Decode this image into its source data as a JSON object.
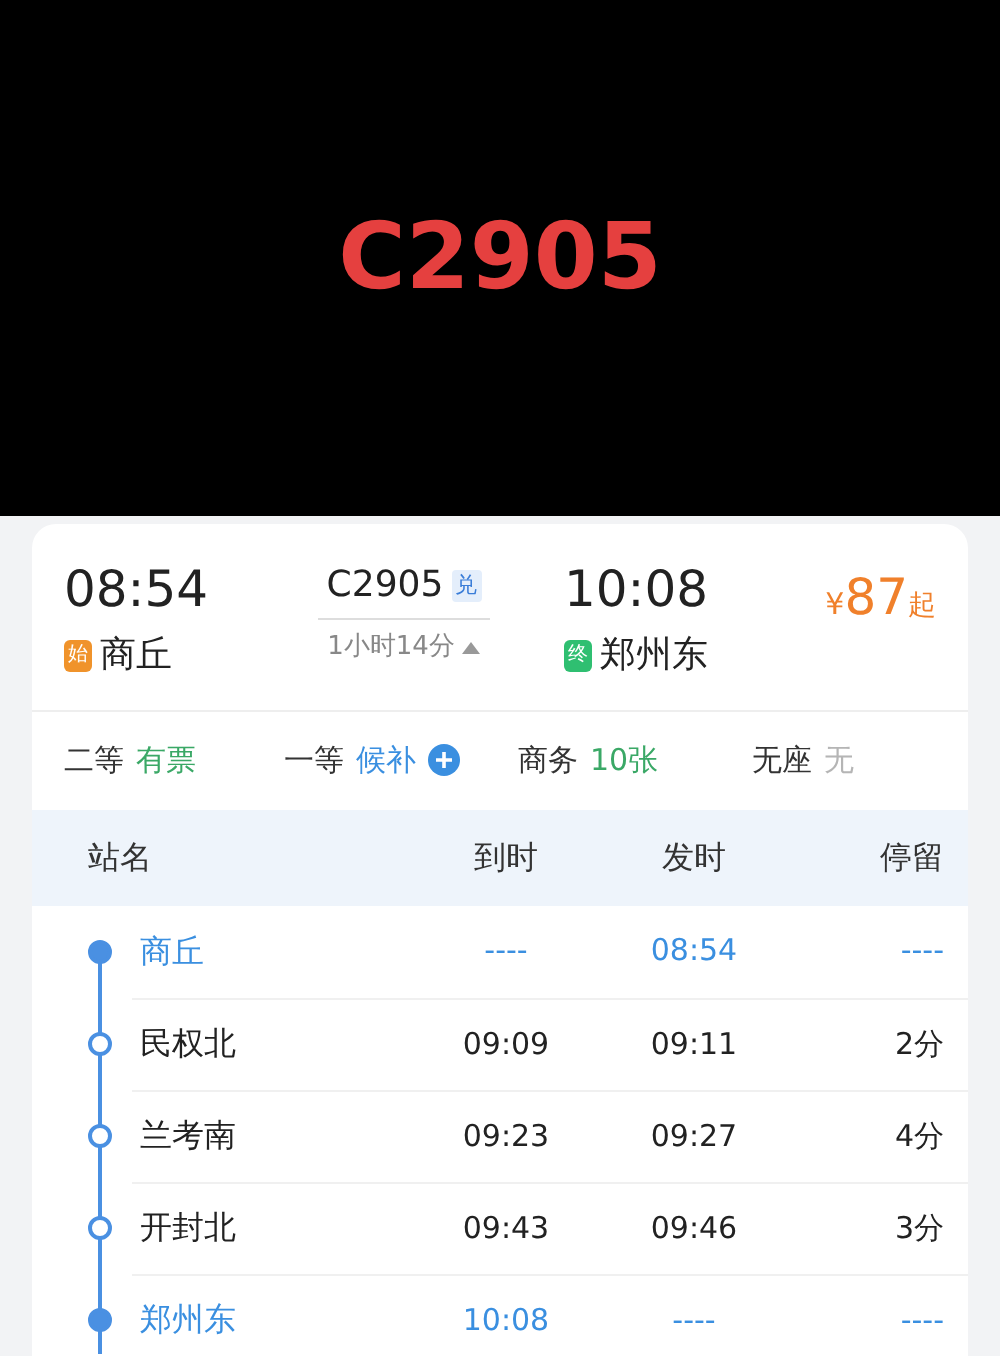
{
  "banner": {
    "title": "C2905"
  },
  "train": {
    "depart_time": "08:54",
    "depart_badge": "始",
    "depart_station": "商丘",
    "number": "C2905",
    "number_badge": "兑",
    "duration": "1小时14分",
    "arrive_time": "10:08",
    "arrive_badge": "终",
    "arrive_station": "郑州东",
    "price_symbol": "¥",
    "price": "87",
    "price_suffix": "起"
  },
  "seats": [
    {
      "class": "二等",
      "status": "有票",
      "kind": "available"
    },
    {
      "class": "一等",
      "status": "候补",
      "kind": "waitlist"
    },
    {
      "class": "商务",
      "status": "10张",
      "kind": "available"
    },
    {
      "class": "无座",
      "status": "无",
      "kind": "none"
    }
  ],
  "table": {
    "columns": [
      "站名",
      "到时",
      "发时",
      "停留"
    ],
    "rows": [
      {
        "station": "商丘",
        "arrive": "----",
        "depart": "08:54",
        "stop": "----",
        "kind": "endpoint"
      },
      {
        "station": "民权北",
        "arrive": "09:09",
        "depart": "09:11",
        "stop": "2分",
        "kind": "stop"
      },
      {
        "station": "兰考南",
        "arrive": "09:23",
        "depart": "09:27",
        "stop": "4分",
        "kind": "stop"
      },
      {
        "station": "开封北",
        "arrive": "09:43",
        "depart": "09:46",
        "stop": "3分",
        "kind": "stop"
      },
      {
        "station": "郑州东",
        "arrive": "10:08",
        "depart": "----",
        "stop": "----",
        "kind": "endpoint"
      }
    ]
  }
}
